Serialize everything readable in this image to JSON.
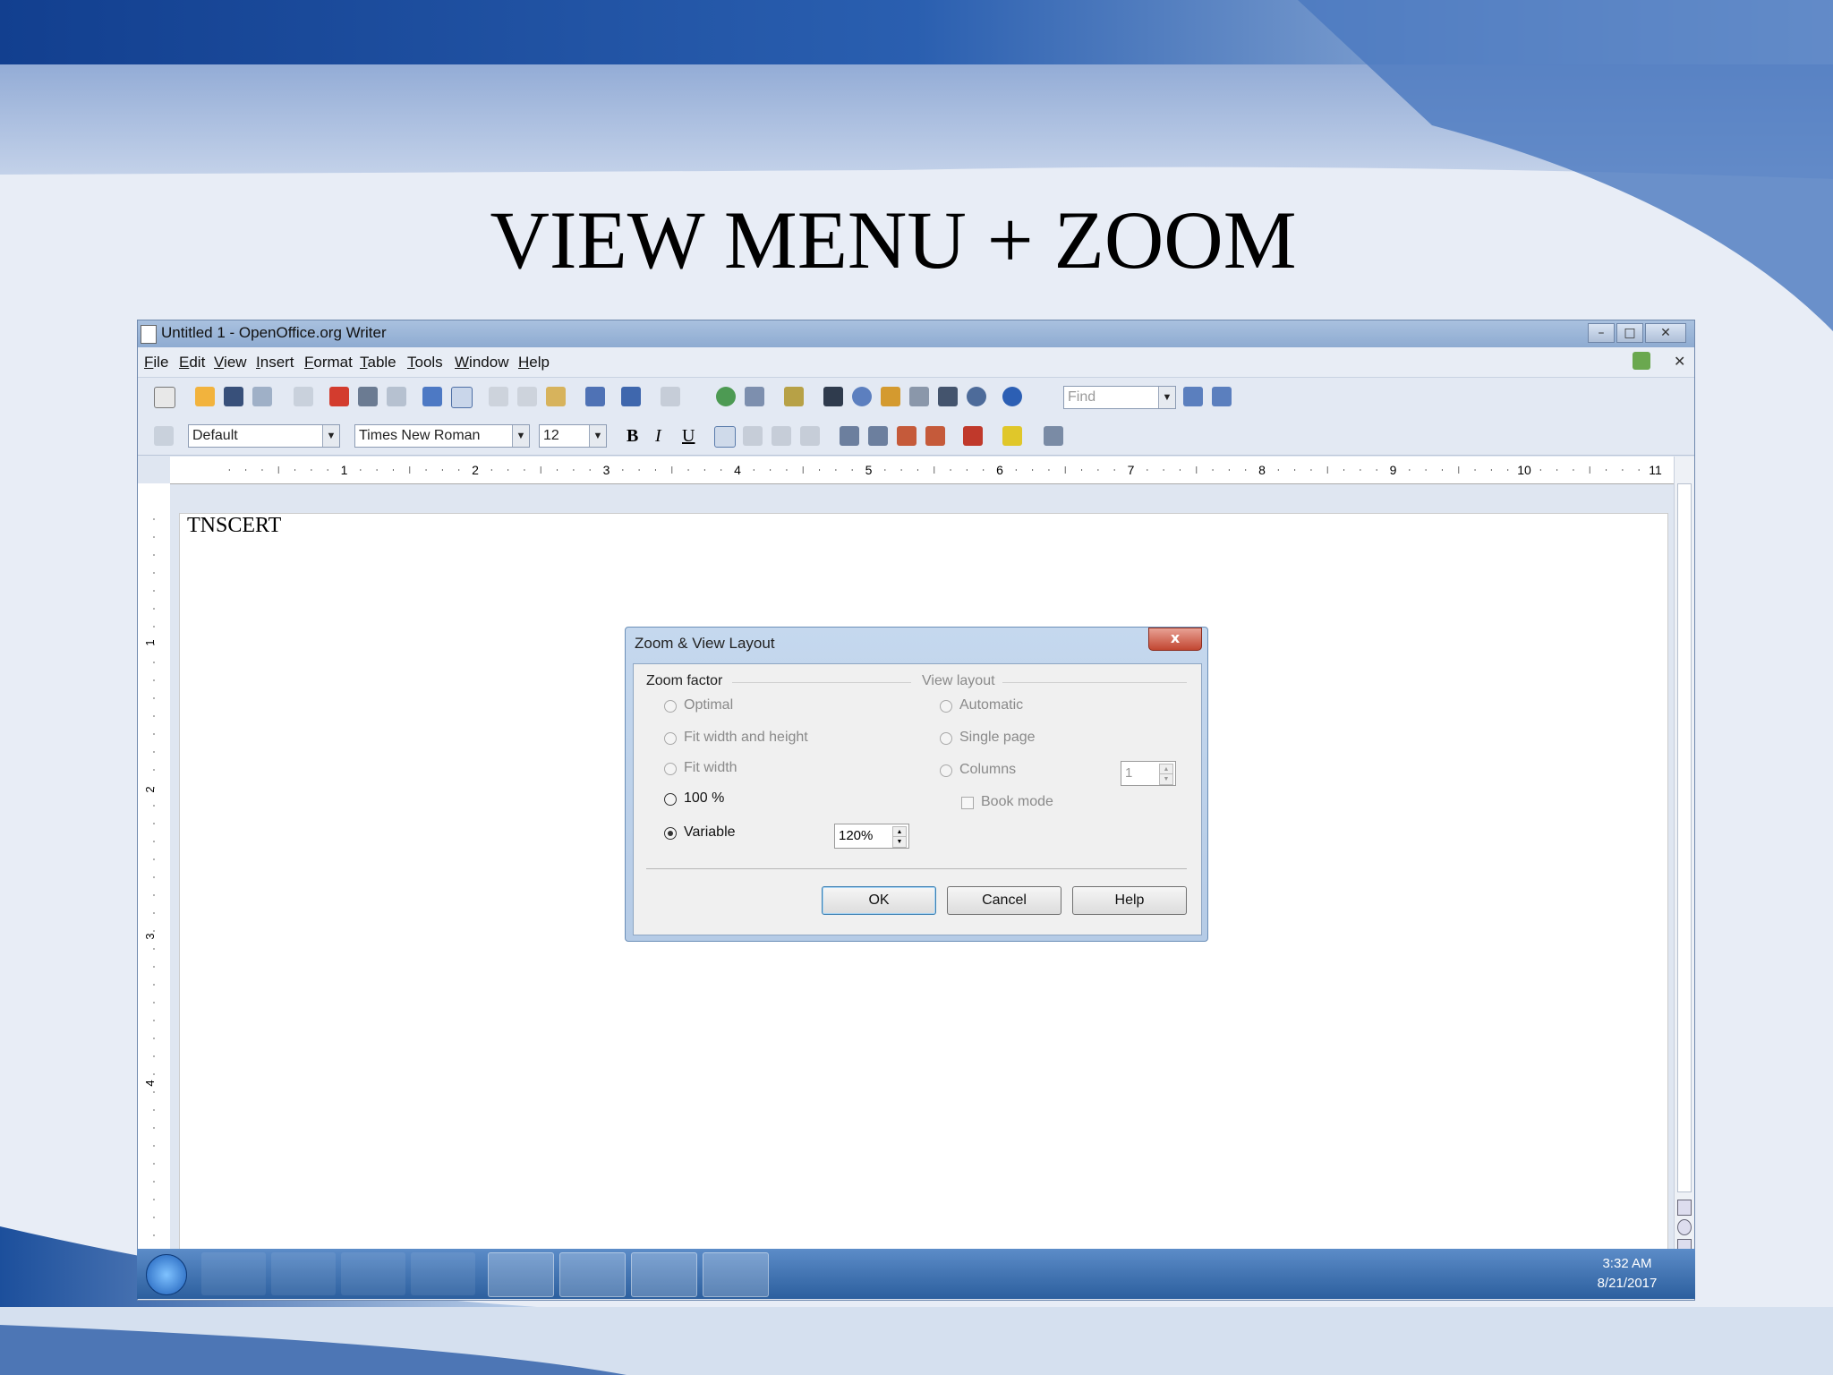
{
  "slide": {
    "title": "VIEW MENU + ZOOM"
  },
  "window": {
    "title": "Untitled 1 - OpenOffice.org Writer",
    "minimize": "–",
    "restore": "□",
    "close": "✕"
  },
  "menu": [
    "File",
    "Edit",
    "View",
    "Insert",
    "Format",
    "Table",
    "Tools",
    "Window",
    "Help"
  ],
  "doc_close": "✕",
  "toolbar": {
    "find_placeholder": "Find",
    "paragraph_style": "Default",
    "font_name": "Times New Roman",
    "font_size": "12",
    "bold": "B",
    "italic": "I",
    "underline": "U"
  },
  "ruler_numbers": [
    "1",
    "2",
    "3",
    "4",
    "5",
    "6",
    "7",
    "8",
    "9",
    "10",
    "11"
  ],
  "vruler_numbers": [
    "1",
    "2",
    "3",
    "4"
  ],
  "document": {
    "text": "TNSCERT"
  },
  "dialog": {
    "title": "Zoom & View Layout",
    "close": "x",
    "zoom_factor_label": "Zoom factor",
    "view_layout_label": "View layout",
    "zoom_options": [
      {
        "label": "Optimal",
        "enabled": false,
        "selected": false
      },
      {
        "label": "Fit width and height",
        "enabled": false,
        "selected": false
      },
      {
        "label": "Fit width",
        "enabled": false,
        "selected": false
      },
      {
        "label": "100 %",
        "enabled": true,
        "selected": false
      },
      {
        "label": "Variable",
        "enabled": true,
        "selected": true
      }
    ],
    "variable_value": "120%",
    "layout_options": [
      {
        "label": "Automatic",
        "enabled": false
      },
      {
        "label": "Single page",
        "enabled": false
      },
      {
        "label": "Columns",
        "enabled": false
      }
    ],
    "columns_value": "1",
    "book_mode_label": "Book mode",
    "ok_label": "OK",
    "cancel_label": "Cancel",
    "help_label": "Help"
  },
  "taskbar": {
    "time": "3:32 AM",
    "date": "8/21/2017"
  },
  "colors": {
    "accent": "#2c5f9e",
    "title_bar": "#8eabd1",
    "dialog_close": "#c24631"
  }
}
